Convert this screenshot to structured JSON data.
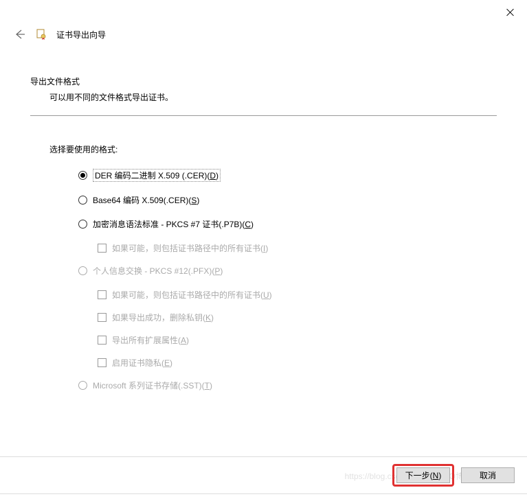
{
  "header": {
    "title": "证书导出向导"
  },
  "section": {
    "title": "导出文件格式",
    "desc": "可以用不同的文件格式导出证书。"
  },
  "select_label": "选择要使用的格式:",
  "options": {
    "der": {
      "label": "DER 编码二进制 X.509 (.CER)(",
      "accel": "D",
      "suffix": ")",
      "checked": true
    },
    "base64": {
      "label": "Base64 编码 X.509(.CER)(",
      "accel": "S",
      "suffix": ")"
    },
    "pkcs7": {
      "label": "加密消息语法标准 - PKCS #7 证书(.P7B)(",
      "accel": "C",
      "suffix": ")",
      "chk_include": {
        "label": "如果可能，则包括证书路径中的所有证书(",
        "accel": "I",
        "suffix": ")"
      }
    },
    "pfx": {
      "label": "个人信息交换 - PKCS #12(.PFX)(",
      "accel": "P",
      "suffix": ")",
      "chk_include": {
        "label": "如果可能，则包括证书路径中的所有证书(",
        "accel": "U",
        "suffix": ")"
      },
      "chk_delete": {
        "label": "如果导出成功，删除私钥(",
        "accel": "K",
        "suffix": ")"
      },
      "chk_ext": {
        "label": "导出所有扩展属性(",
        "accel": "A",
        "suffix": ")"
      },
      "chk_privacy": {
        "label": "启用证书隐私(",
        "accel": "E",
        "suffix": ")"
      }
    },
    "sst": {
      "label": "Microsoft 系列证书存储(.SST)(",
      "accel": "T",
      "suffix": ")"
    }
  },
  "footer": {
    "next": "下一步(",
    "next_accel": "N",
    "next_suffix": ")",
    "cancel": "取消"
  },
  "watermark": "https://blog.csdn.net/@61CTO博客"
}
